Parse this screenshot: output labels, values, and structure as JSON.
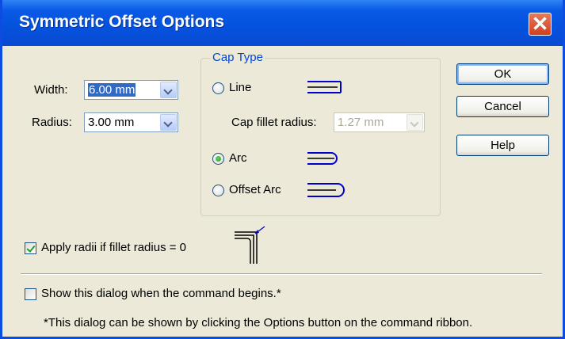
{
  "window": {
    "title": "Symmetric Offset Options",
    "close_glyph": "✕"
  },
  "width": {
    "label": "Width:",
    "value": "6.00 mm"
  },
  "radius": {
    "label": "Radius:",
    "value": "3.00 mm"
  },
  "cap_type": {
    "legend": "Cap Type",
    "options": [
      {
        "label": "Line",
        "selected": false,
        "icon": "line-cap-icon"
      },
      {
        "label": "Arc",
        "selected": true,
        "icon": "arc-cap-icon"
      },
      {
        "label": "Offset Arc",
        "selected": false,
        "icon": "offset-arc-cap-icon"
      }
    ],
    "fillet": {
      "label": "Cap fillet radius:",
      "value": "1.27 mm",
      "enabled": false
    }
  },
  "buttons": {
    "ok": "OK",
    "cancel": "Cancel",
    "help": "Help"
  },
  "apply_radii": {
    "label": "Apply radii if fillet radius = 0",
    "checked": true,
    "icon": "fillet-corner-icon"
  },
  "show_dialog": {
    "label": "Show this dialog when the command begins.*",
    "checked": false
  },
  "footnote": "*This dialog can be shown by clicking the Options button on the command ribbon.",
  "colors": {
    "title_bar": "#0453df",
    "legend": "#0046d5",
    "close_button": "#d1401f",
    "check_mark": "#21a121"
  }
}
